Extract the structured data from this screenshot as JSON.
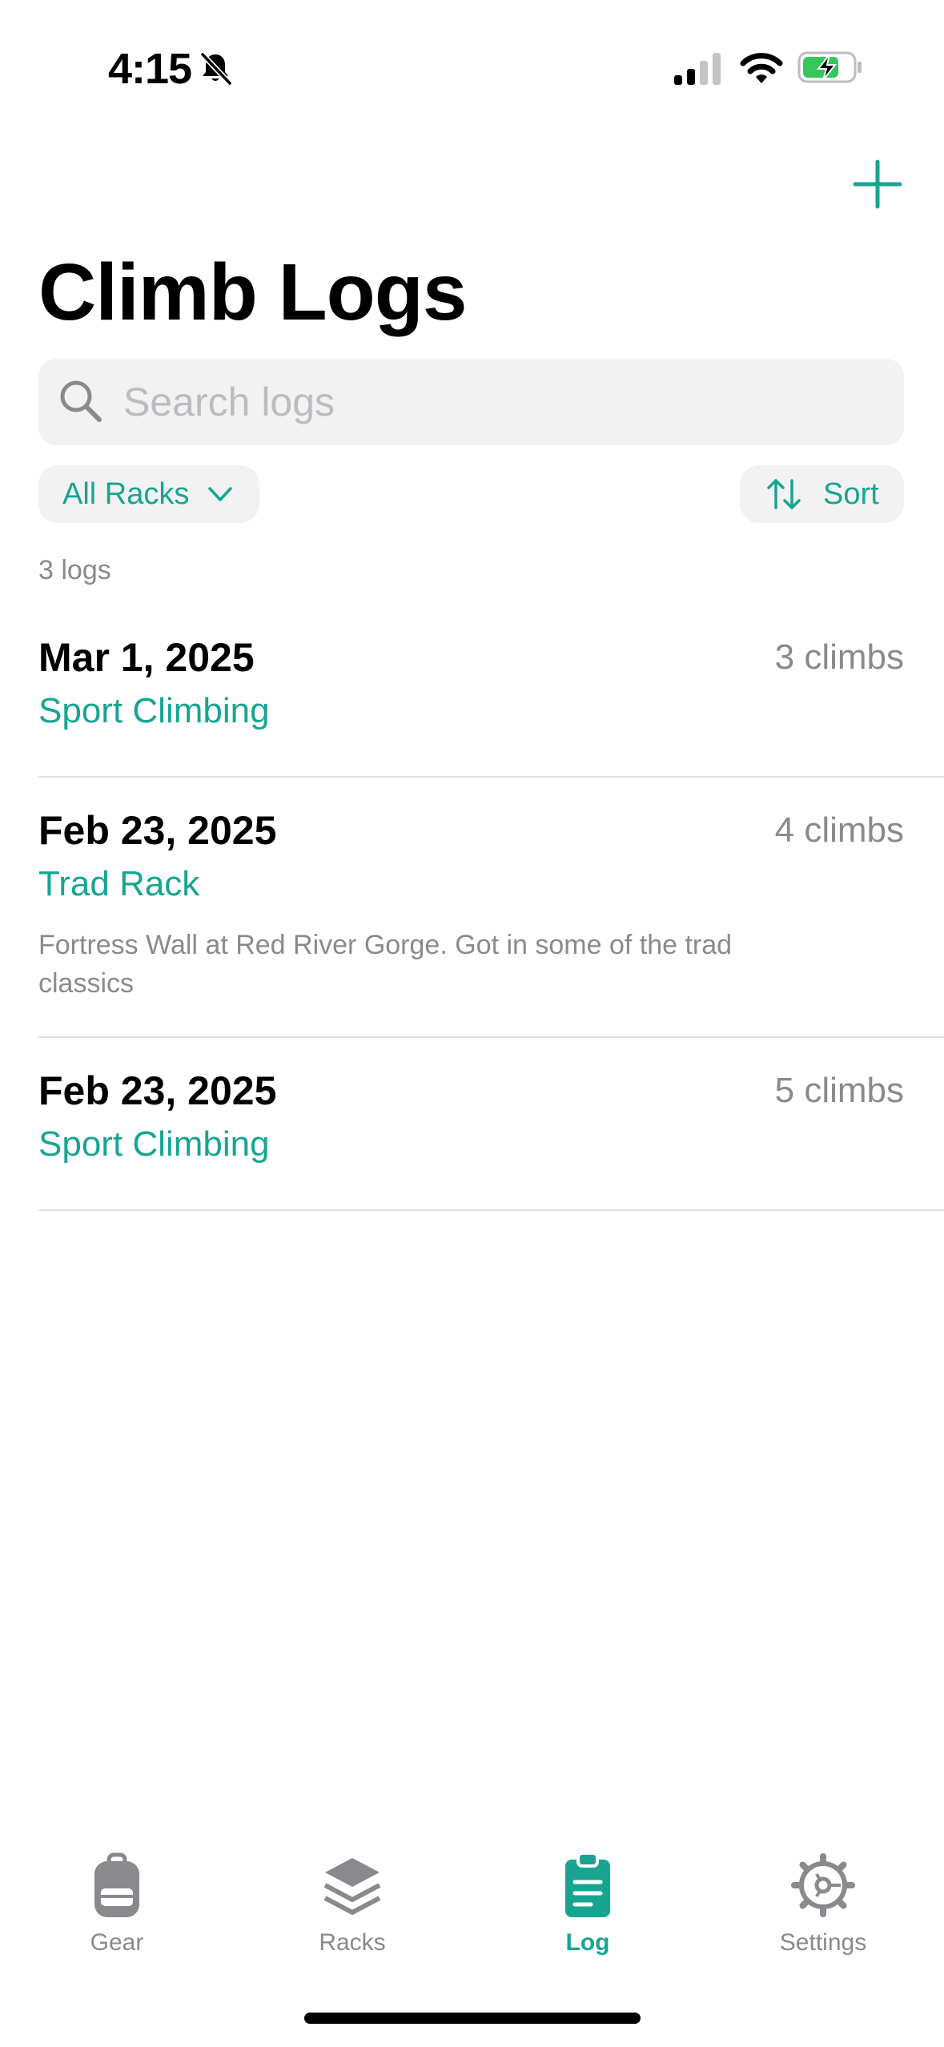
{
  "status_bar": {
    "time": "4:15",
    "icons": [
      "bell-slash-icon",
      "cellular-signal-icon",
      "wifi-icon",
      "battery-charging-icon"
    ]
  },
  "header": {
    "title": "Climb Logs",
    "add_icon": "plus-icon"
  },
  "search": {
    "placeholder": "Search logs",
    "value": ""
  },
  "filters": {
    "rack_filter_label": "All Racks",
    "sort_label": "Sort"
  },
  "summary": {
    "count_text": "3 logs"
  },
  "logs": [
    {
      "date": "Mar 1, 2025",
      "climbs": "3 climbs",
      "rack": "Sport Climbing",
      "note": ""
    },
    {
      "date": "Feb 23, 2025",
      "climbs": "4 climbs",
      "rack": "Trad Rack",
      "note": "Fortress Wall at Red River Gorge. Got in some of the trad classics"
    },
    {
      "date": "Feb 23, 2025",
      "climbs": "5 climbs",
      "rack": "Sport Climbing",
      "note": ""
    }
  ],
  "tab_bar": {
    "tabs": [
      {
        "label": "Gear",
        "icon": "backpack-icon",
        "active": false
      },
      {
        "label": "Racks",
        "icon": "stack-icon",
        "active": false
      },
      {
        "label": "Log",
        "icon": "clipboard-icon",
        "active": true
      },
      {
        "label": "Settings",
        "icon": "gear-icon",
        "active": false
      }
    ]
  },
  "colors": {
    "accent": "#17a591",
    "secondary_text": "#8a8a8e",
    "chip_background": "#f2f2f3"
  }
}
